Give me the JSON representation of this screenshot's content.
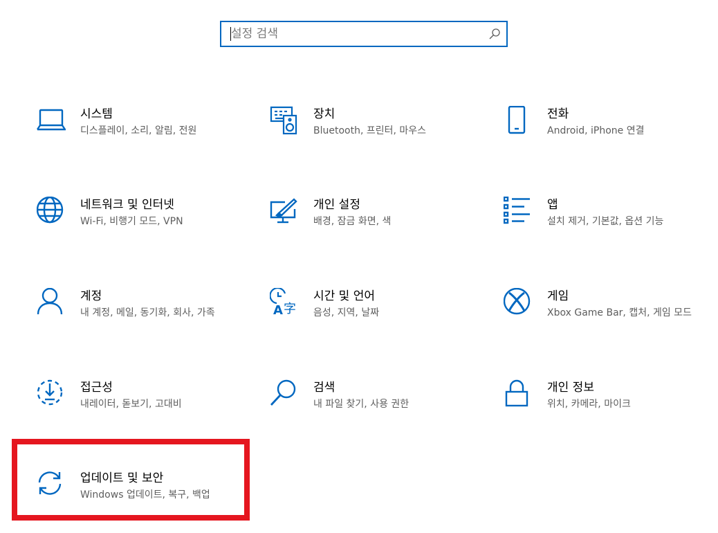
{
  "search": {
    "placeholder": "설정 검색",
    "value": ""
  },
  "accent_color": "#0067c0",
  "highlight_color": "#e5161f",
  "tiles": [
    {
      "title": "시스템",
      "desc": "디스플레이, 소리, 알림, 전원",
      "icon": "laptop-icon"
    },
    {
      "title": "장치",
      "desc": "Bluetooth, 프린터, 마우스",
      "icon": "devices-icon"
    },
    {
      "title": "전화",
      "desc": "Android, iPhone 연결",
      "icon": "phone-icon"
    },
    {
      "title": "네트워크 및 인터넷",
      "desc": "Wi-Fi, 비행기 모드, VPN",
      "icon": "globe-icon"
    },
    {
      "title": "개인 설정",
      "desc": "배경, 잠금 화면, 색",
      "icon": "personalization-icon"
    },
    {
      "title": "앱",
      "desc": "설치 제거, 기본값, 옵션 기능",
      "icon": "apps-list-icon"
    },
    {
      "title": "계정",
      "desc": "내 계정, 메일, 동기화, 회사, 가족",
      "icon": "person-icon"
    },
    {
      "title": "시간 및 언어",
      "desc": "음성, 지역, 날짜",
      "icon": "time-language-icon"
    },
    {
      "title": "게임",
      "desc": "Xbox Game Bar, 캡처, 게임 모드",
      "icon": "xbox-icon"
    },
    {
      "title": "접근성",
      "desc": "내레이터, 돋보기, 고대비",
      "icon": "ease-of-access-icon"
    },
    {
      "title": "검색",
      "desc": "내 파일 찾기, 사용 권한",
      "icon": "search-icon"
    },
    {
      "title": "개인 정보",
      "desc": "위치, 카메라, 마이크",
      "icon": "lock-icon"
    },
    {
      "title": "업데이트 및 보안",
      "desc": "Windows 업데이트, 복구, 백업",
      "icon": "sync-icon"
    }
  ]
}
